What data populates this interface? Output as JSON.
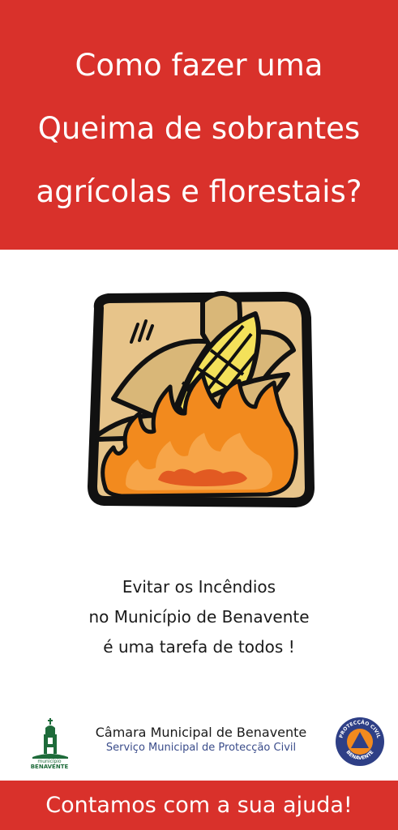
{
  "header": {
    "title_lines": [
      "Como fazer uma",
      "Queima de sobrantes",
      "agrícolas e florestais?"
    ]
  },
  "illustration": {
    "icon": "corn-on-fire-icon"
  },
  "slogan": {
    "lines": [
      "Evitar os Incêndios",
      "no Município de Benavente",
      "é uma tarefa de todos !"
    ]
  },
  "footer": {
    "municipality_logo": {
      "icon": "municipality-tower-icon",
      "caption_small": "município",
      "caption_big": "BENAVENTE"
    },
    "org_name": "Câmara Municipal de Benavente",
    "org_service": "Serviço Municipal de Protecção Civil",
    "civil_protection_logo": {
      "icon": "civil-protection-emblem-icon",
      "ring_top": "PROTECÇÃO CIVIL",
      "ring_bottom": "BENAVENTE"
    }
  },
  "bottom_banner": {
    "text": "Contamos com a sua ajuda!"
  },
  "colors": {
    "banner_red": "#d9312b",
    "service_blue": "#3a4c8a",
    "logo_green": "#1e6b3a",
    "flame_orange": "#f28a1e",
    "tan_background": "#e7c48a"
  }
}
